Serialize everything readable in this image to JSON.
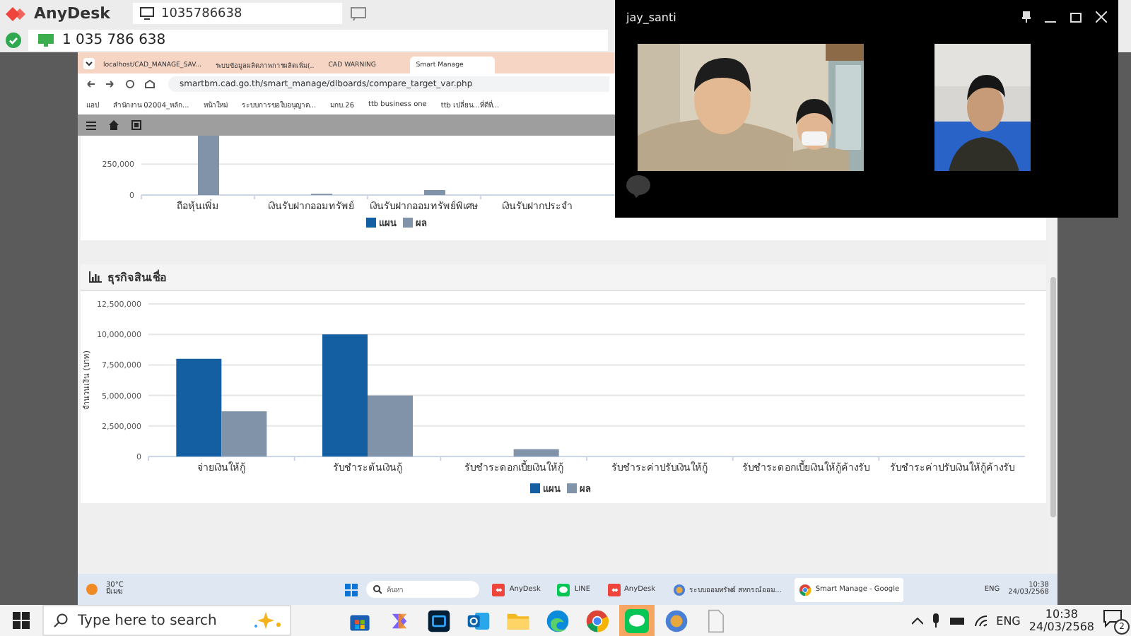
{
  "anydesk": {
    "app_name": "AnyDesk",
    "tab_id": "1035786638",
    "address": "1 035 786 638"
  },
  "browser": {
    "tabs": [
      {
        "title": "localhost/CAD_MANAGE_SAV...",
        "selected": false
      },
      {
        "title": "ระบบข้อมูลผลิตภาพการผลิตเพิ่ม(..",
        "selected": false
      },
      {
        "title": "CAD WARNING",
        "selected": false
      },
      {
        "title": "Smart Manage",
        "selected": true
      }
    ],
    "url": "smartbm.cad.go.th/smart_manage/dlboards/compare_target_var.php",
    "bookmarks": [
      "แอป",
      "สำนักงาน 02004_หลัก...",
      "หน้าใหม่",
      "ระบบการขอใบอนุญาต...",
      "มกบ.26",
      "ttb business one",
      "ttb เปลี่ยน...ที่ดีที่..."
    ]
  },
  "deposit_chart": {
    "chart_data": {
      "type": "bar",
      "categories": [
        "ถือหุ้นเพิ่ม",
        "เงินรับฝากออมทรัพย์",
        "เงินรับฝากออมทรัพย์พิเศษ",
        "เงินรับฝากประจำ"
      ],
      "series": [
        {
          "name": "แผน",
          "color": "#135fa1",
          "values": [
            0,
            0,
            0,
            0
          ]
        },
        {
          "name": "ผล",
          "color": "#8093a8",
          "values": [
            480000,
            10000,
            40000,
            0
          ]
        }
      ],
      "ylim": [
        0,
        480000
      ],
      "grid": true,
      "legend": true,
      "yticks": [
        {
          "value": 0,
          "label": "0"
        },
        {
          "value": 250000,
          "label": "250,000"
        }
      ]
    }
  },
  "loan_section": {
    "title": "ธุรกิจสินเชื่อ",
    "chart_data": {
      "type": "bar",
      "ylabel": "จำนวนเงิน (บาท)",
      "categories": [
        "จ่ายเงินให้กู้",
        "รับชำระต้นเงินกู้",
        "รับชำระดอกเบี้ยเงินให้กู้",
        "รับชำระค่าปรับเงินให้กู้",
        "รับชำระดอกเบี้ยเงินให้กู้ค้างรับ",
        "รับชำระค่าปรับเงินให้กู้ค้างรับ"
      ],
      "series": [
        {
          "name": "แผน",
          "color": "#135fa1",
          "values": [
            8000000,
            10000000,
            0,
            0,
            0,
            0
          ]
        },
        {
          "name": "ผล",
          "color": "#8093a8",
          "values": [
            3700000,
            5000000,
            600000,
            0,
            0,
            0
          ]
        }
      ],
      "ylim": [
        0,
        12500000
      ],
      "grid": true,
      "legend": true,
      "yticks": [
        {
          "value": 0,
          "label": "0"
        },
        {
          "value": 2500000,
          "label": "2,500,000"
        },
        {
          "value": 5000000,
          "label": "5,000,000"
        },
        {
          "value": 7500000,
          "label": "7,500,000"
        },
        {
          "value": 10000000,
          "label": "10,000,000"
        },
        {
          "value": 12500000,
          "label": "12,500,000"
        }
      ]
    }
  },
  "remote_taskbar": {
    "temperature": "30°C",
    "weather": "มีเมฆ",
    "search_placeholder": "ค้นหา",
    "apps": [
      {
        "label": "AnyDesk",
        "kind": "anydesk",
        "selected": false
      },
      {
        "label": "LINE",
        "kind": "line",
        "selected": false
      },
      {
        "label": "AnyDesk",
        "kind": "anydesk",
        "selected": false
      },
      {
        "label": "ระบบออมทรัพย์ สหกรณ์ออม...",
        "kind": "app",
        "selected": false
      },
      {
        "label": "Smart Manage - Google",
        "kind": "chrome",
        "selected": true
      }
    ],
    "language": "ENG",
    "time": "10:38",
    "date": "24/03/2568"
  },
  "video_call": {
    "title": "jay_santi"
  },
  "taskbar": {
    "search_placeholder": "Type here to search",
    "apps": [
      {
        "kind": "store",
        "selected": false
      },
      {
        "kind": "copilot",
        "selected": false
      },
      {
        "kind": "photoshop",
        "selected": false
      },
      {
        "kind": "outlook",
        "selected": false
      },
      {
        "kind": "explorer",
        "selected": false
      },
      {
        "kind": "edge",
        "selected": false
      },
      {
        "kind": "chrome",
        "selected": false
      },
      {
        "kind": "line",
        "selected": true
      },
      {
        "kind": "app",
        "selected": false
      },
      {
        "kind": "file",
        "selected": false
      }
    ],
    "language": "ENG",
    "time": "10:38",
    "date": "24/03/2568",
    "notification_count": "2"
  }
}
